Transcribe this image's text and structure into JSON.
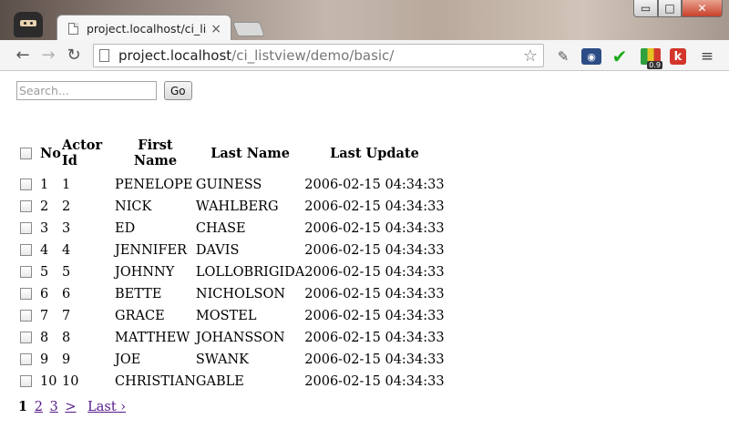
{
  "browser": {
    "tab_title": "project.localhost/ci_listvie",
    "tab_close": "×",
    "url_host": "project.localhost",
    "url_path": "/ci_listview/demo/basic/",
    "window_controls": {
      "minimize": "▭",
      "maximize": "□",
      "close": "✕"
    },
    "nav": {
      "back": "←",
      "forward": "→",
      "reload": "↻"
    },
    "extensions": {
      "dropper": "✎",
      "camera": "◉",
      "check": "✔",
      "stats_badge": "0.9",
      "klout": "k",
      "menu": "≡"
    }
  },
  "search": {
    "placeholder": "Search...",
    "value": "",
    "button_label": "Go"
  },
  "table": {
    "headers": {
      "no": "No",
      "actor_id": "Actor Id",
      "first_name": "First Name",
      "last_name": "Last Name",
      "last_update": "Last Update"
    },
    "rows": [
      {
        "no": "1",
        "actor_id": "1",
        "first_name": "PENELOPE",
        "last_name": "GUINESS",
        "last_update": "2006-02-15 04:34:33"
      },
      {
        "no": "2",
        "actor_id": "2",
        "first_name": "NICK",
        "last_name": "WAHLBERG",
        "last_update": "2006-02-15 04:34:33"
      },
      {
        "no": "3",
        "actor_id": "3",
        "first_name": "ED",
        "last_name": "CHASE",
        "last_update": "2006-02-15 04:34:33"
      },
      {
        "no": "4",
        "actor_id": "4",
        "first_name": "JENNIFER",
        "last_name": "DAVIS",
        "last_update": "2006-02-15 04:34:33"
      },
      {
        "no": "5",
        "actor_id": "5",
        "first_name": "JOHNNY",
        "last_name": "LOLLOBRIGIDA",
        "last_update": "2006-02-15 04:34:33"
      },
      {
        "no": "6",
        "actor_id": "6",
        "first_name": "BETTE",
        "last_name": "NICHOLSON",
        "last_update": "2006-02-15 04:34:33"
      },
      {
        "no": "7",
        "actor_id": "7",
        "first_name": "GRACE",
        "last_name": "MOSTEL",
        "last_update": "2006-02-15 04:34:33"
      },
      {
        "no": "8",
        "actor_id": "8",
        "first_name": "MATTHEW",
        "last_name": "JOHANSSON",
        "last_update": "2006-02-15 04:34:33"
      },
      {
        "no": "9",
        "actor_id": "9",
        "first_name": "JOE",
        "last_name": "SWANK",
        "last_update": "2006-02-15 04:34:33"
      },
      {
        "no": "10",
        "actor_id": "10",
        "first_name": "CHRISTIAN",
        "last_name": "GABLE",
        "last_update": "2006-02-15 04:34:33"
      }
    ]
  },
  "pagination": {
    "current": "1",
    "pages": [
      "2",
      "3"
    ],
    "next": ">",
    "last": "Last ›"
  }
}
